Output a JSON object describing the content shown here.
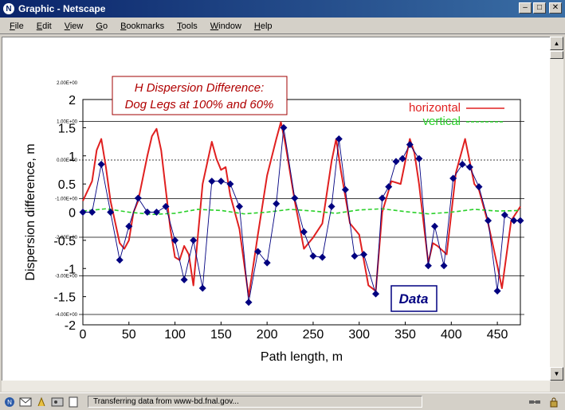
{
  "window": {
    "title": "Graphic - Netscape",
    "app_icon_label": "N"
  },
  "menu": {
    "items": [
      "File",
      "Edit",
      "View",
      "Go",
      "Bookmarks",
      "Tools",
      "Window",
      "Help"
    ]
  },
  "status": {
    "text": "Transferring data from www-bd.fnal.gov..."
  },
  "chart_annotation": {
    "line1": "H Dispersion Difference:",
    "line2": "Dog Legs at 100% and 60%",
    "data_label": "Data"
  },
  "chart_data": {
    "type": "line",
    "xlabel": "Path length, m",
    "ylabel": "Dispersion difference, m",
    "xlim": [
      0,
      475
    ],
    "ylim": [
      -2,
      2
    ],
    "x_ticks": [
      "0",
      "50",
      "100",
      "150",
      "200",
      "250",
      "300",
      "350",
      "400",
      "450"
    ],
    "y_ticks": [
      "2",
      "1.5",
      "1",
      "0.5",
      "0",
      "-0.5",
      "-1",
      "-1.5",
      "-2"
    ],
    "legend_placement": "top-right",
    "series": [
      {
        "name": "horizontal",
        "color": "#e02020",
        "style": "solid",
        "x": [
          0,
          10,
          15,
          20,
          25,
          30,
          40,
          45,
          50,
          55,
          60,
          65,
          70,
          75,
          80,
          85,
          90,
          95,
          100,
          105,
          110,
          115,
          120,
          130,
          140,
          145,
          150,
          155,
          160,
          170,
          180,
          190,
          200,
          210,
          215,
          220,
          230,
          240,
          250,
          260,
          270,
          275,
          280,
          290,
          300,
          310,
          318,
          325,
          335,
          345,
          355,
          360,
          365,
          375,
          380,
          385,
          395,
          405,
          415,
          425,
          430,
          440,
          450,
          455,
          465,
          475
        ],
        "y": [
          0.2,
          0.55,
          1.1,
          1.3,
          0.8,
          0.2,
          -0.55,
          -0.65,
          -0.5,
          0.0,
          0.2,
          0.6,
          1.0,
          1.35,
          1.48,
          1.1,
          0.4,
          -0.3,
          -0.8,
          -0.85,
          -0.6,
          -0.75,
          -1.3,
          0.5,
          1.25,
          0.95,
          0.75,
          0.8,
          0.3,
          -0.3,
          -1.5,
          -0.4,
          0.65,
          1.3,
          1.6,
          1.2,
          0.2,
          -0.65,
          -0.45,
          -0.2,
          0.9,
          1.3,
          0.75,
          -0.2,
          -0.4,
          -1.3,
          -1.4,
          0.0,
          0.55,
          0.5,
          1.3,
          1.05,
          0.5,
          -0.9,
          -0.55,
          -0.6,
          -0.75,
          0.7,
          1.3,
          0.5,
          0.4,
          -0.2,
          -0.95,
          -1.35,
          -0.15,
          0.1
        ]
      },
      {
        "name": "vertical",
        "color": "#2ad02a",
        "style": "dashed",
        "x": [
          0,
          25,
          50,
          75,
          100,
          125,
          150,
          175,
          200,
          225,
          250,
          275,
          300,
          325,
          350,
          375,
          400,
          425,
          450,
          475
        ],
        "y": [
          0.02,
          0.06,
          0.0,
          -0.04,
          -0.02,
          0.05,
          0.03,
          -0.03,
          0.0,
          0.05,
          0.02,
          -0.02,
          0.04,
          0.06,
          0.01,
          -0.03,
          0.0,
          0.05,
          0.02,
          0.03
        ]
      },
      {
        "name": "Data",
        "color": "#000080",
        "style": "markers",
        "x": [
          0,
          10,
          20,
          30,
          40,
          50,
          60,
          70,
          80,
          90,
          100,
          110,
          120,
          130,
          140,
          150,
          160,
          170,
          180,
          190,
          200,
          210,
          218,
          230,
          240,
          250,
          260,
          270,
          278,
          285,
          295,
          305,
          318,
          325,
          332,
          340,
          347,
          355,
          365,
          375,
          382,
          392,
          402,
          412,
          420,
          430,
          440,
          450,
          458,
          468,
          475
        ],
        "y": [
          0.0,
          0.0,
          0.85,
          0.0,
          -0.85,
          -0.25,
          0.25,
          0.0,
          0.0,
          0.1,
          -0.5,
          -1.2,
          -0.5,
          -1.35,
          0.55,
          0.55,
          0.5,
          0.1,
          -1.6,
          -0.7,
          -0.9,
          0.15,
          1.5,
          0.25,
          -0.35,
          -0.78,
          -0.8,
          0.1,
          1.3,
          0.4,
          -0.78,
          -0.75,
          -1.45,
          0.25,
          0.45,
          0.9,
          0.95,
          1.2,
          0.95,
          -0.95,
          -0.25,
          -0.95,
          0.6,
          0.85,
          0.8,
          0.45,
          -0.15,
          -1.4,
          -0.05,
          -0.15,
          -0.15
        ]
      }
    ],
    "secondary_axis_labels": [
      "2.00E+00",
      "1.00E+00",
      "0.00E+00",
      "-1.00E+00",
      "-2.00E+00",
      "-3.00E+00",
      "-4.00E+00"
    ]
  }
}
